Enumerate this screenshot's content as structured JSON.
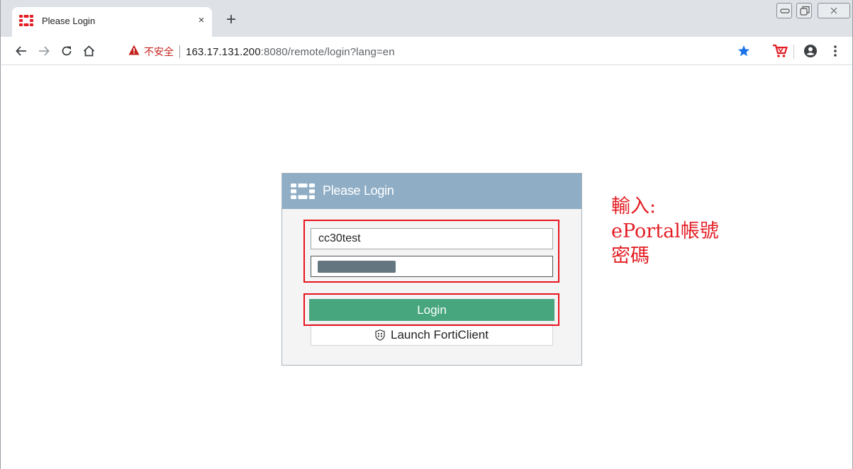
{
  "browser": {
    "tab": {
      "title": "Please Login",
      "close": "×"
    },
    "new_tab": "+",
    "address": {
      "security_label": "不安全",
      "url_host": "163.17.131.200",
      "url_rest": ":8080/remote/login?lang=en"
    },
    "icons": {
      "back": "back-arrow-icon",
      "forward": "forward-arrow-icon",
      "reload": "reload-icon",
      "home": "home-icon",
      "warning": "warning-triangle-icon",
      "bookmark": "star-icon",
      "extension": "cart-icon",
      "profile": "account-icon",
      "menu": "kebab-menu-icon"
    }
  },
  "login": {
    "header_title": "Please Login",
    "username_value": "cc30test",
    "login_button": "Login",
    "launch_button": "Launch FortiClient"
  },
  "annotation": {
    "line1": "輸入:",
    "line2": "ePortal帳號",
    "line3": "密碼",
    "color": "#e31e24"
  },
  "colors": {
    "header_bg": "#8faec6",
    "login_button_bg": "#47a67e",
    "highlight": "#e8141e"
  }
}
